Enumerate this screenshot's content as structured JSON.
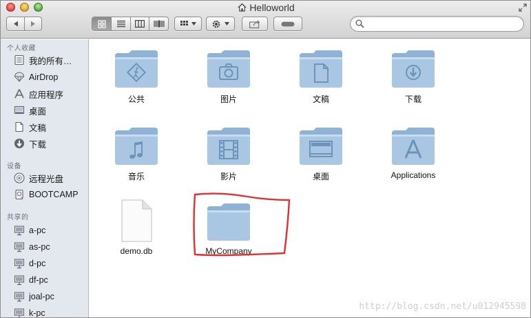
{
  "window": {
    "title": "Helloworld"
  },
  "sidebar": {
    "favorites_header": "个人收藏",
    "favorites": [
      {
        "label": "我的所有…",
        "icon": "all-files-icon"
      },
      {
        "label": "AirDrop",
        "icon": "airdrop-icon"
      },
      {
        "label": "应用程序",
        "icon": "applications-icon"
      },
      {
        "label": "桌面",
        "icon": "desktop-icon"
      },
      {
        "label": "文稿",
        "icon": "documents-icon"
      },
      {
        "label": "下载",
        "icon": "downloads-icon"
      }
    ],
    "devices_header": "设备",
    "devices": [
      {
        "label": "远程光盘",
        "icon": "remote-disc-icon"
      },
      {
        "label": "BOOTCAMP",
        "icon": "drive-icon"
      }
    ],
    "shared_header": "共享的",
    "shared": [
      {
        "label": "a-pc",
        "icon": "computer-icon"
      },
      {
        "label": "as-pc",
        "icon": "computer-icon"
      },
      {
        "label": "d-pc",
        "icon": "computer-icon"
      },
      {
        "label": "df-pc",
        "icon": "computer-icon"
      },
      {
        "label": "joal-pc",
        "icon": "computer-icon"
      },
      {
        "label": "k-pc",
        "icon": "computer-icon"
      }
    ]
  },
  "files": [
    {
      "label": "公共",
      "icon": "public-folder-icon"
    },
    {
      "label": "图片",
      "icon": "pictures-folder-icon"
    },
    {
      "label": "文稿",
      "icon": "documents-folder-icon"
    },
    {
      "label": "下载",
      "icon": "downloads-folder-icon"
    },
    {
      "label": "音乐",
      "icon": "music-folder-icon"
    },
    {
      "label": "影片",
      "icon": "movies-folder-icon"
    },
    {
      "label": "桌面",
      "icon": "desktop-folder-icon"
    },
    {
      "label": "Applications",
      "icon": "applications-folder-icon"
    },
    {
      "label": "demo.db",
      "icon": "document-file-icon"
    },
    {
      "label": "MyCompany",
      "icon": "folder-icon"
    }
  ],
  "watermark": "http://blog.csdn.net/u012945598",
  "colors": {
    "folder": "#9ebfde",
    "annotation": "#e0302f",
    "sidebar_bg": "#e3e8ee"
  }
}
